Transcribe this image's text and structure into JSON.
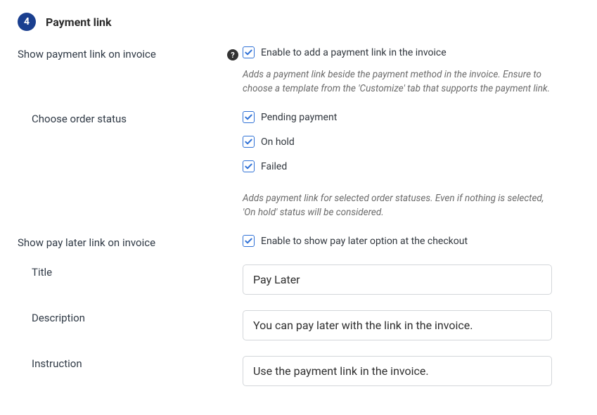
{
  "section": {
    "step_number": "4",
    "title": "Payment link"
  },
  "rows": {
    "show_link": {
      "label": "Show payment link on invoice",
      "checkbox_label": "Enable to add a payment link in the invoice",
      "help": "Adds a payment link beside the payment method in the invoice. Ensure to choose a template from the 'Customize' tab that supports the payment link."
    },
    "order_status": {
      "label": "Choose order status",
      "options": {
        "pending": "Pending payment",
        "on_hold": "On hold",
        "failed": "Failed"
      },
      "help": "Adds payment link for selected order statuses. Even if nothing is selected, 'On hold' status will be considered."
    },
    "pay_later": {
      "label": "Show pay later link on invoice",
      "checkbox_label": "Enable to show pay later option at the checkout"
    },
    "title_field": {
      "label": "Title",
      "value": "Pay Later"
    },
    "description_field": {
      "label": "Description",
      "value": "You can pay later with the link in the invoice."
    },
    "instruction_field": {
      "label": "Instruction",
      "value": "Use the payment link in the invoice."
    }
  }
}
